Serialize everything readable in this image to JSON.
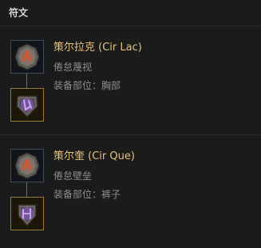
{
  "panel": {
    "title": "符文"
  },
  "runes": [
    {
      "name": "策尔拉克 (Cir Lac)",
      "description": "倦怠蔑视",
      "slot": "装备部位：胸部",
      "top_icon": "cir-rune-stone-icon",
      "bottom_icon": "lac-rune-stone-icon",
      "glyph_color": "#e0522a"
    },
    {
      "name": "策尔奎 (Cir Que)",
      "description": "倦怠壁垒",
      "slot": "装备部位：裤子",
      "top_icon": "cir-rune-stone-icon",
      "bottom_icon": "que-rune-stone-icon",
      "glyph_color": "#e0522a"
    }
  ],
  "colors": {
    "rune_name": "#e7c27e",
    "secondary_text": "#8f8f8f",
    "common_frame": "#3d4b5c",
    "legendary_frame": "#9a7a2e",
    "purple_glyph": "#c98cff"
  }
}
